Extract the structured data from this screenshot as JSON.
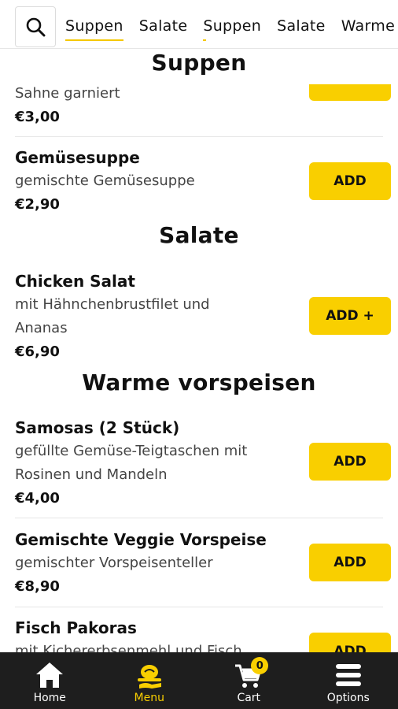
{
  "tabs": [
    "Suppen",
    "Salate",
    "Suppen",
    "Salate",
    "Warme"
  ],
  "sections": {
    "suppen": "Suppen",
    "salate": "Salate",
    "warme": "Warme vorspeisen"
  },
  "items": [
    {
      "name": "",
      "desc": "Sahne garniert",
      "price": "€3,00",
      "button": ""
    },
    {
      "name": "Gemüsesuppe",
      "desc": "gemischte Gemüsesuppe",
      "price": "€2,90",
      "button": "ADD"
    },
    {
      "name": "Chicken Salat",
      "desc": "mit Hähnchenbrustfilet und Ananas",
      "price": "€6,90",
      "button": "ADD +"
    },
    {
      "name": "Samosas (2 Stück)",
      "desc": "gefüllte Gemüse-Teigtaschen mit Rosinen und Mandeln",
      "price": "€4,00",
      "button": "ADD"
    },
    {
      "name": "Gemischte Veggie Vorspeise",
      "desc": "gemischter Vorspeisenteller",
      "price": "€8,90",
      "button": "ADD"
    },
    {
      "name": "Fisch Pakoras",
      "desc": "mit Kichererbsenmehl und Fisch",
      "price": "",
      "button": "ADD"
    }
  ],
  "nav": {
    "home": "Home",
    "menu": "Menu",
    "cart": "Cart",
    "cart_count": "0",
    "options": "Options"
  },
  "colors": {
    "accent": "#f9cf00",
    "nav_bg": "#1e1e1e"
  }
}
